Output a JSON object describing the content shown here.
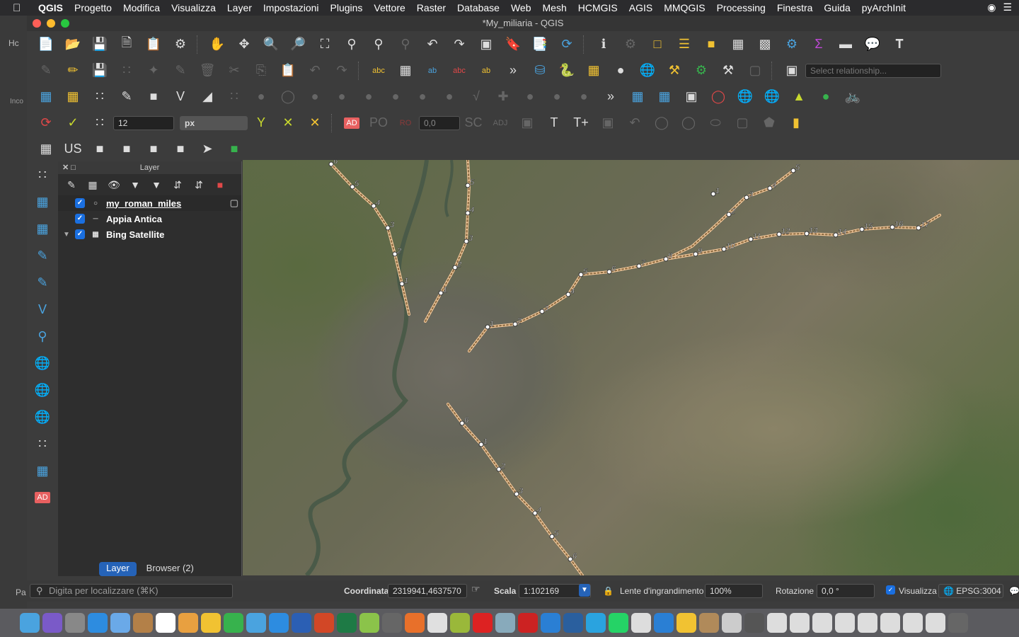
{
  "menubar": {
    "app": "QGIS",
    "items": [
      "Progetto",
      "Modifica",
      "Visualizza",
      "Layer",
      "Impostazioni",
      "Plugins",
      "Vettore",
      "Raster",
      "Database",
      "Web",
      "Mesh",
      "HCMGIS",
      "AGIS",
      "MMQGIS",
      "Processing",
      "Finestra",
      "Guida",
      "pyArchInit"
    ]
  },
  "background_window": {
    "tab": "Hc",
    "label": "Inco",
    "bottom": "Pa"
  },
  "window": {
    "title": "*My_miliaria - QGIS"
  },
  "toolbar": {
    "relationship_placeholder": "Select relationship...",
    "snap_tolerance": "12",
    "snap_unit": "px",
    "ad_label": "AD",
    "angle_value": "0,0"
  },
  "layer_panel": {
    "title": "Layer",
    "layers": [
      {
        "name": "my_roman_miles",
        "checked": true
      },
      {
        "name": "Appia Antica",
        "checked": true
      },
      {
        "name": "Bing Satellite",
        "checked": true
      }
    ],
    "tab_layer": "Layer",
    "tab_browser": "Browser (2)"
  },
  "map": {
    "route_color": "#f2c79a",
    "mile_labels": [
      "6",
      "5",
      "4",
      "3",
      "2",
      "1",
      "5",
      "4",
      "3",
      "2",
      "1",
      "1",
      "2",
      "3",
      "4",
      "5",
      "6",
      "7",
      "8",
      "9",
      "10",
      "11",
      "12",
      "13",
      "14",
      "15",
      "16",
      "17",
      "1",
      "2",
      "3",
      "4",
      "5",
      "6",
      "1",
      "2",
      "3",
      "4",
      "5",
      "6",
      "7"
    ]
  },
  "statusbar": {
    "search_placeholder": "Digita per localizzare (⌘K)",
    "coord_label": "Coordinata",
    "coord_value": "2319941,4637570",
    "scale_label": "Scala",
    "scale_value": "1:102169",
    "magnifier_label": "Lente d'ingrandimento",
    "magnifier_value": "100%",
    "rotation_label": "Rotazione",
    "rotation_value": "0,0 °",
    "render_label": "Visualizza",
    "crs": "EPSG:3004"
  }
}
